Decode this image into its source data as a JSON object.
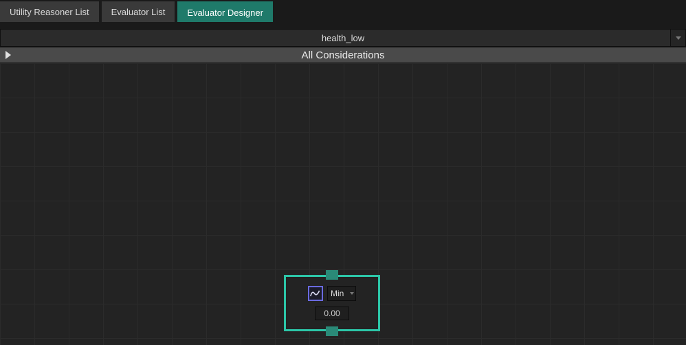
{
  "tabs": [
    {
      "label": "Utility Reasoner List",
      "active": false
    },
    {
      "label": "Evaluator List",
      "active": false
    },
    {
      "label": "Evaluator Designer",
      "active": true
    }
  ],
  "titleDropdown": {
    "selected": "health_low"
  },
  "sectionHeader": {
    "label": "All Considerations"
  },
  "node": {
    "modeLabel": "Min",
    "value": "0.00"
  }
}
